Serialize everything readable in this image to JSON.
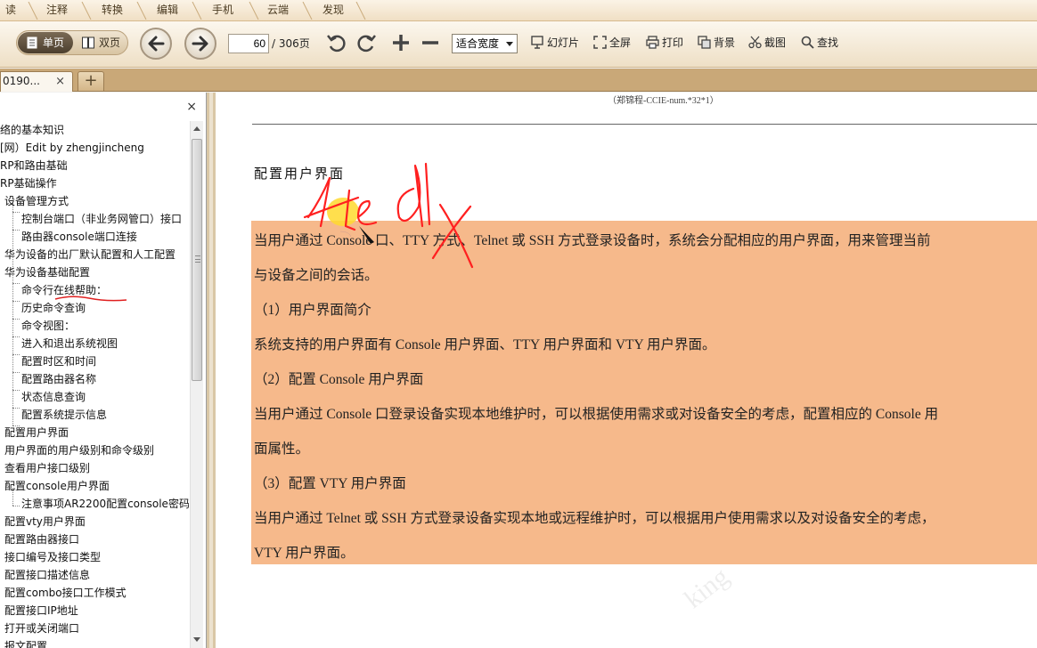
{
  "menu": [
    "读",
    "注释",
    "转换",
    "编辑",
    "手机",
    "云端",
    "发现"
  ],
  "toolbar": {
    "single_page": "单页",
    "double_page": "双页",
    "current_page": "60",
    "total_pages": "/ 306页",
    "zoom": "适合宽度",
    "slideshow": "幻灯片",
    "fullscreen": "全屏",
    "print": "打印",
    "background": "背景",
    "screenshot": "截图",
    "find": "查找"
  },
  "tabs": {
    "doc_tab": "0190...",
    "close": "×",
    "new_tab": "+"
  },
  "sidebar": {
    "close": "×",
    "items": [
      "络的基本知识",
      "[网）Edit by zhengjincheng",
      "RP和路由基础",
      "RP基础操作",
      "设备管理方式",
      "控制台端口（非业务网管口）接口（",
      "路由器console端口连接",
      "华为设备的出厂默认配置和人工配置",
      "华为设备基础配置",
      "命令行在线帮助：",
      "历史命令查询",
      "命令视图：",
      "进入和退出系统视图",
      "配置时区和时间",
      "配置路由器名称",
      "状态信息查询",
      "配置系统提示信息",
      "配置用户界面",
      "用户界面的用户级别和命令级别",
      "查看用户接口级别",
      "配置console用户界面",
      "注意事项AR2200配置console密码",
      "配置vty用户界面",
      "配置路由器接口",
      "接口编号及接口类型",
      "配置接口描述信息",
      "配置combo接口工作模式",
      "配置接口IP地址",
      "打开或关闭端口",
      "报文配置"
    ]
  },
  "document": {
    "header_note": "（郑锦程-CCIE-num.*32*1）",
    "heading": "配置用户界面",
    "lines": [
      "当用户通过 Console 口、TTY 方式、Telnet 或 SSH 方式登录设备时，系统会分配相应的用户界面，用来管理当前",
      "与设备之间的会话。",
      "（1）用户界面简介",
      "系统支持的用户界面有 Console 用户界面、TTY 用户界面和 VTY 用户界面。",
      "（2）配置 Console 用户界面",
      "当用户通过 Console 口登录设备实现本地维护时，可以根据使用需求或对设备安全的考虑，配置相应的 Console 用",
      "面属性。",
      "（3）配置 VTY 用户界面",
      "当用户通过 Telnet 或 SSH 方式登录设备实现本地或远程维护时，可以根据用户使用需求以及对设备安全的考虑，",
      "VTY 用户界面。"
    ],
    "watermark": "king"
  },
  "colors": {
    "highlight": "#f6b98b",
    "ink": "#ff2020",
    "hyperlink": "#2a2aa8"
  }
}
